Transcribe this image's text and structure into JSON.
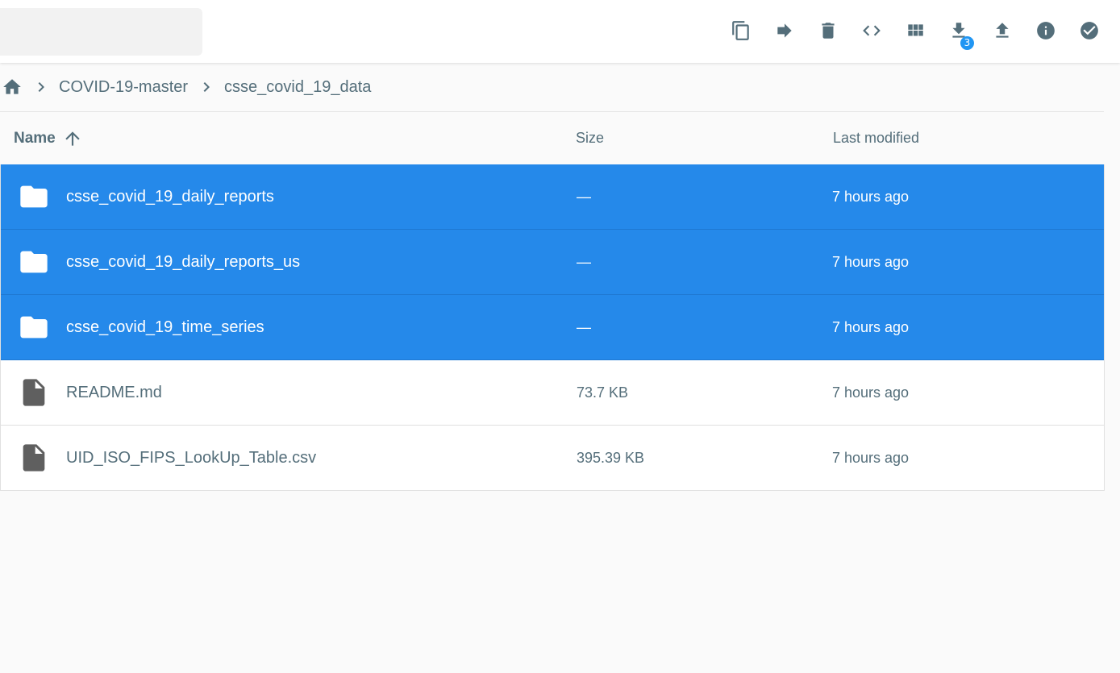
{
  "toolbar": {
    "search_placeholder": "",
    "actions": [
      {
        "name": "copy-icon",
        "label": "Copy"
      },
      {
        "name": "move-icon",
        "label": "Move"
      },
      {
        "name": "delete-icon",
        "label": "Delete"
      },
      {
        "name": "embed-icon",
        "label": "Embed"
      },
      {
        "name": "grid-view-icon",
        "label": "Switch view"
      },
      {
        "name": "download-icon",
        "label": "Download"
      },
      {
        "name": "upload-icon",
        "label": "Upload"
      },
      {
        "name": "info-icon",
        "label": "Info"
      },
      {
        "name": "select-all-icon",
        "label": "Select"
      }
    ],
    "download_badge": "3",
    "accent_color": "#2196f3"
  },
  "breadcrumbs": {
    "home_icon": "home-icon",
    "items": [
      "COVID-19-master",
      "csse_covid_19_data"
    ]
  },
  "list_header": {
    "name": "Name",
    "size": "Size",
    "modified": "Last modified",
    "sort_icon": "arrow-up-icon"
  },
  "rows": [
    {
      "type": "folder",
      "name": "csse_covid_19_daily_reports",
      "size": "—",
      "modified": "7 hours ago",
      "selected": true
    },
    {
      "type": "folder",
      "name": "csse_covid_19_daily_reports_us",
      "size": "—",
      "modified": "7 hours ago",
      "selected": true
    },
    {
      "type": "folder",
      "name": "csse_covid_19_time_series",
      "size": "—",
      "modified": "7 hours ago",
      "selected": true
    },
    {
      "type": "file",
      "name": "README.md",
      "size": "73.7 KB",
      "modified": "7 hours ago",
      "selected": false
    },
    {
      "type": "file",
      "name": "UID_ISO_FIPS_LookUp_Table.csv",
      "size": "395.39 KB",
      "modified": "7 hours ago",
      "selected": false
    }
  ],
  "selection_color": "#2589ea"
}
